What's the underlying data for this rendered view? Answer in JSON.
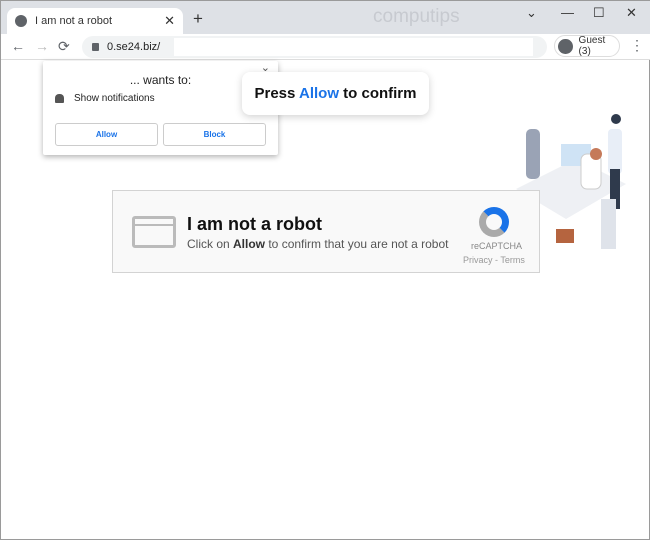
{
  "browser": {
    "tab_title": "I am not a robot",
    "new_tab": "+",
    "watermark": "computips",
    "url": "0.se24.biz/",
    "profile": "Guest (3)",
    "icons": {
      "back": "←",
      "forward": "→",
      "reload": "⟳",
      "menu": "⋮",
      "tab_close": "✕",
      "tabsearch": "⌄",
      "minimize": "—",
      "maximize": "☐",
      "close": "✕"
    }
  },
  "permission_popup": {
    "wants": "... wants to:",
    "permission": "Show notifications",
    "allow": "Allow",
    "block": "Block",
    "chevron": "⌄"
  },
  "bubble": {
    "pre": "Press ",
    "allow": "Allow",
    "post": " to confirm"
  },
  "captcha": {
    "title": "I am not a robot",
    "sub_pre": "Click on ",
    "sub_bold": "Allow",
    "sub_post": " to confirm that you are not a robot",
    "brand": "reCAPTCHA",
    "links": "Privacy - Terms"
  }
}
